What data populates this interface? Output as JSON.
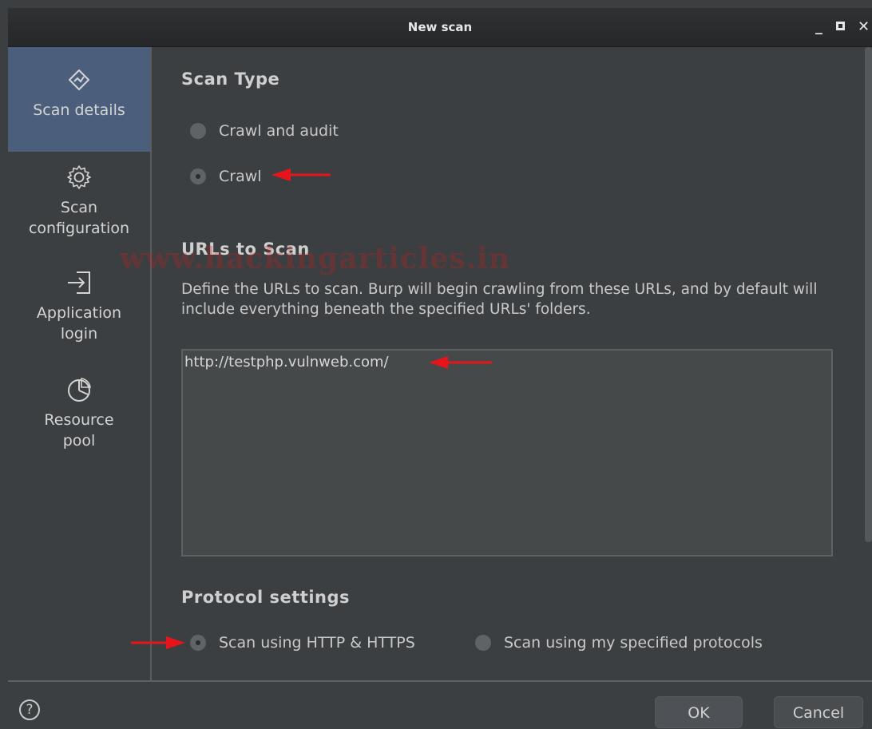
{
  "window": {
    "title": "New scan"
  },
  "sidebar": {
    "items": [
      {
        "label": "Scan details",
        "icon": "compass-icon",
        "active": true
      },
      {
        "label": "Scan\nconfiguration",
        "icon": "gear-icon",
        "active": false
      },
      {
        "label": "Application\nlogin",
        "icon": "login-arrow-icon",
        "active": false
      },
      {
        "label": "Resource\npool",
        "icon": "pie-chart-icon",
        "active": false
      }
    ]
  },
  "scan_type": {
    "heading": "Scan Type",
    "options": [
      {
        "label": "Crawl and audit",
        "checked": false
      },
      {
        "label": "Crawl",
        "checked": true
      }
    ]
  },
  "urls": {
    "heading": "URLs to Scan",
    "description": "Define the URLs to scan. Burp will begin crawling from these URLs, and by default will include everything beneath the specified URLs' folders.",
    "value": "http://testphp.vulnweb.com/"
  },
  "protocol": {
    "heading": "Protocol settings",
    "options": [
      {
        "label": "Scan using HTTP & HTTPS",
        "checked": true
      },
      {
        "label": "Scan using my specified protocols",
        "checked": false
      }
    ]
  },
  "footer": {
    "help": "?",
    "ok_label": "OK",
    "cancel_label": "Cancel"
  },
  "watermark": "www.hackingarticles.in",
  "colors": {
    "active_nav": "#4b5e7c",
    "annotation_arrow": "#e8141b",
    "background": "#3c3f41"
  }
}
